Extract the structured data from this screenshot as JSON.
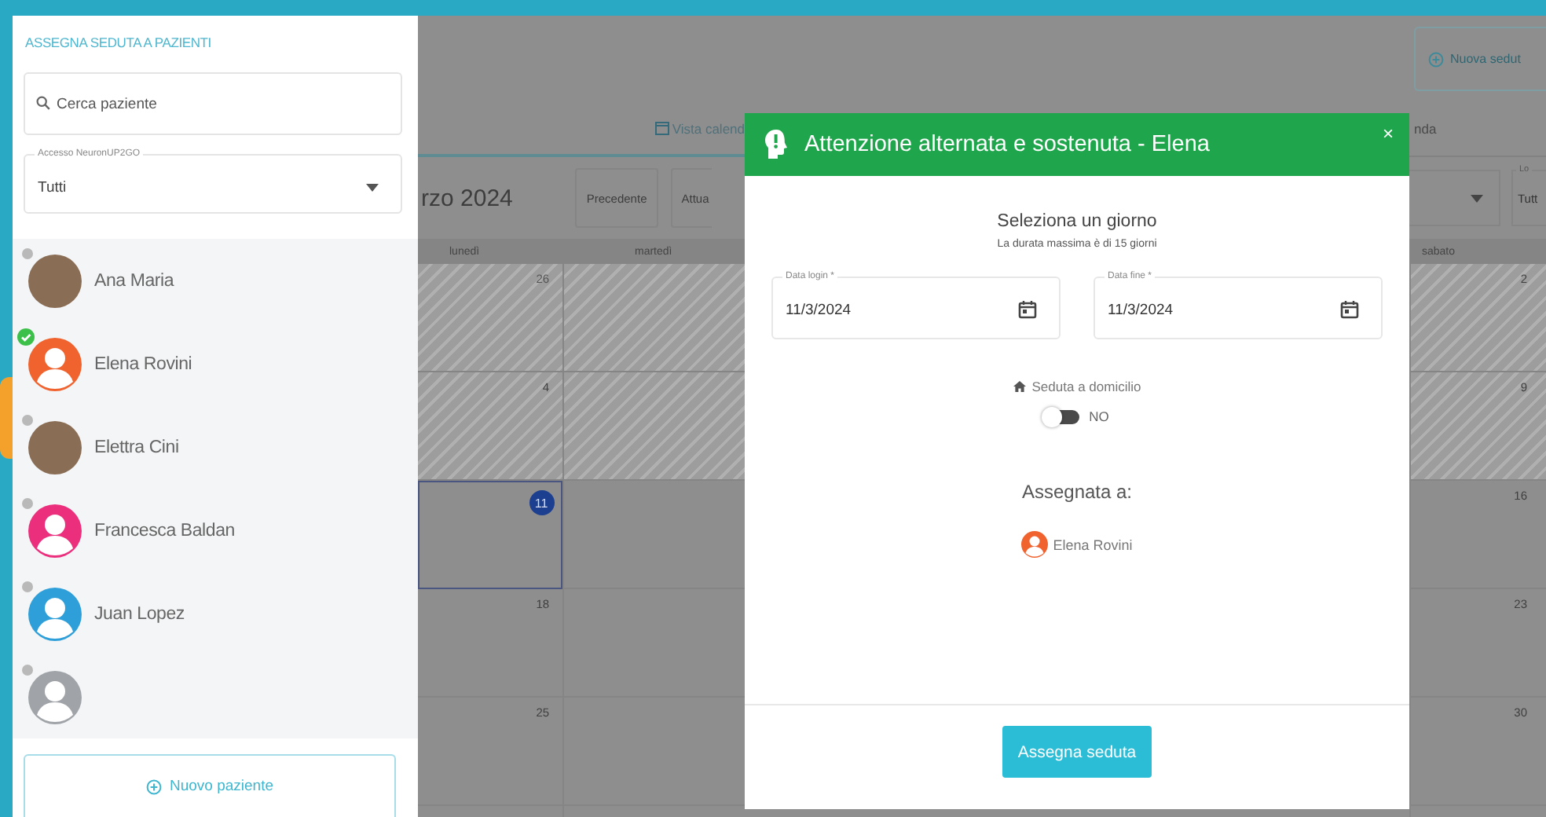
{
  "sidebar": {
    "title": "ASSEGNA SEDUTA A PAZIENTI",
    "search": {
      "placeholder": "Cerca paziente"
    },
    "filter": {
      "label": "Accesso NeuronUP2GO",
      "value": "Tutti"
    },
    "patients": [
      {
        "name": "Ana Maria",
        "kind": "photo",
        "selected": false
      },
      {
        "name": "Elena Rovini",
        "kind": "silhouette",
        "color": "#f0622e",
        "selected": true
      },
      {
        "name": "Elettra Cini",
        "kind": "photo",
        "selected": false
      },
      {
        "name": "Francesca Baldan",
        "kind": "silhouette",
        "color": "#ec2f7d",
        "selected": false
      },
      {
        "name": "Juan Lopez",
        "kind": "silhouette",
        "color": "#2e9fd9",
        "selected": false
      },
      {
        "kind": "default",
        "color": "#a0a3a8",
        "selected": false
      }
    ],
    "new_button": "Nuovo paziente"
  },
  "calendar_view": {
    "new_session_button": "Nuova sedut",
    "tabs": [
      {
        "label": "Vista calend",
        "selected": true
      },
      {
        "label": "nda",
        "selected": false
      }
    ],
    "month": "rzo 2024",
    "nav_buttons": [
      "Precedente",
      "Attua"
    ],
    "filter": {
      "label": "Lo",
      "value": "Tutt"
    },
    "columns": [
      {
        "heading": "lunedì",
        "days": [
          {
            "day": "26",
            "outside": true,
            "past": true,
            "today": false
          },
          {
            "day": "4",
            "outside": false,
            "past": true,
            "today": false
          },
          {
            "day": "11",
            "outside": false,
            "past": false,
            "today": true
          },
          {
            "day": "18",
            "outside": false,
            "past": false,
            "today": false
          },
          {
            "day": "25",
            "outside": false,
            "past": false,
            "today": false
          }
        ]
      },
      {
        "heading": "martedì"
      },
      {
        "heading": "sabato",
        "days": [
          {
            "day": "2",
            "outside": false,
            "past": true,
            "today": false
          },
          {
            "day": "9",
            "outside": false,
            "past": true,
            "today": false
          },
          {
            "day": "16",
            "outside": false,
            "past": false,
            "today": false
          },
          {
            "day": "23",
            "outside": false,
            "past": false,
            "today": false
          },
          {
            "day": "30",
            "outside": false,
            "past": false,
            "today": false
          }
        ]
      }
    ]
  },
  "modal": {
    "title": "Attenzione alternata e sostenuta - Elena",
    "close": "×",
    "heading": "Seleziona un giorno",
    "note": "La durata massima è di 15 giorni",
    "dates": [
      {
        "label": "Data login *",
        "value": "11/3/2024"
      },
      {
        "label": "Data fine *",
        "value": "11/3/2024"
      }
    ],
    "home_visit": {
      "label": "Seduta a domicilio",
      "on": false,
      "state_text": "NO"
    },
    "assigned_heading": "Assegnata a:",
    "assigned": [
      {
        "name": "Elena Rovini",
        "color": "#f0622e"
      }
    ],
    "submit": "Assegna seduta"
  }
}
